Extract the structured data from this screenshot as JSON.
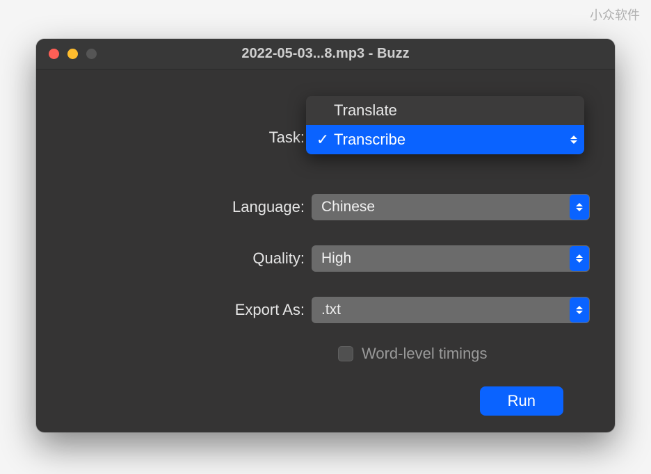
{
  "watermark": "小众软件",
  "window": {
    "title": "2022-05-03...8.mp3 - Buzz"
  },
  "task": {
    "label": "Task:",
    "options": [
      "Translate",
      "Transcribe"
    ],
    "selected": "Transcribe"
  },
  "language": {
    "label": "Language:",
    "value": "Chinese"
  },
  "quality": {
    "label": "Quality:",
    "value": "High"
  },
  "export": {
    "label": "Export As:",
    "value": ".txt"
  },
  "word_timings": {
    "label": "Word-level timings",
    "checked": false
  },
  "run_button": "Run"
}
